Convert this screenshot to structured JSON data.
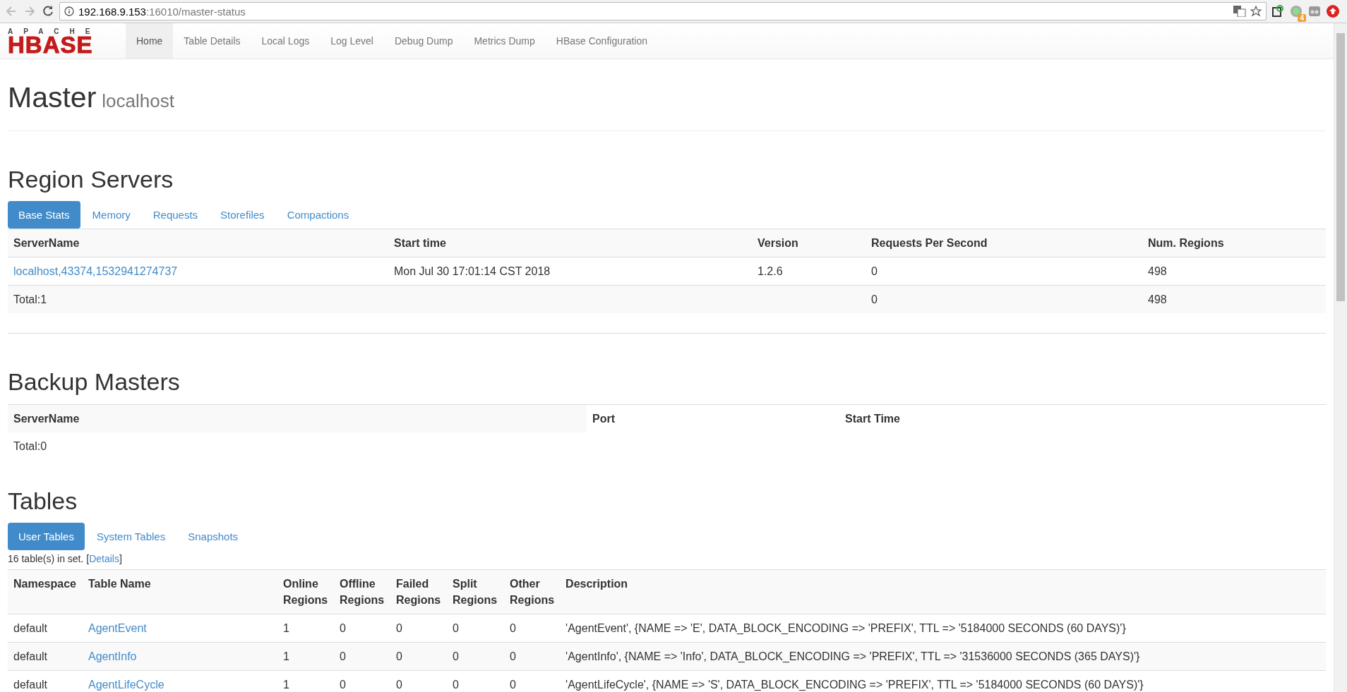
{
  "browser": {
    "url_host": "192.168.9.153",
    "url_path": ":16010/master-status",
    "extension_badge": "4"
  },
  "navbar": {
    "logo_top": "APACHE",
    "logo_main": "HBASE",
    "items": [
      {
        "label": "Home",
        "selected": true
      },
      {
        "label": "Table Details",
        "selected": false
      },
      {
        "label": "Local Logs",
        "selected": false
      },
      {
        "label": "Log Level",
        "selected": false
      },
      {
        "label": "Debug Dump",
        "selected": false
      },
      {
        "label": "Metrics Dump",
        "selected": false
      },
      {
        "label": "HBase Configuration",
        "selected": false
      }
    ]
  },
  "header": {
    "title": "Master",
    "subtitle": "localhost"
  },
  "region_servers": {
    "title": "Region Servers",
    "tabs": [
      {
        "label": "Base Stats",
        "selected": true
      },
      {
        "label": "Memory",
        "selected": false
      },
      {
        "label": "Requests",
        "selected": false
      },
      {
        "label": "Storefiles",
        "selected": false
      },
      {
        "label": "Compactions",
        "selected": false
      }
    ],
    "columns": [
      "ServerName",
      "Start time",
      "Version",
      "Requests Per Second",
      "Num. Regions"
    ],
    "rows": [
      {
        "server_name": "localhost,43374,1532941274737",
        "start_time": "Mon Jul 30 17:01:14 CST 2018",
        "version": "1.2.6",
        "requests_per_second": "0",
        "num_regions": "498"
      }
    ],
    "total": {
      "label": "Total:1",
      "requests_per_second": "0",
      "num_regions": "498"
    }
  },
  "backup_masters": {
    "title": "Backup Masters",
    "columns": [
      "ServerName",
      "Port",
      "Start Time"
    ],
    "total": "Total:0"
  },
  "tables": {
    "title": "Tables",
    "tabs": [
      {
        "label": "User Tables",
        "selected": true
      },
      {
        "label": "System Tables",
        "selected": false
      },
      {
        "label": "Snapshots",
        "selected": false
      }
    ],
    "summary_prefix": "16 table(s) in set. [",
    "summary_link": "Details",
    "summary_suffix": "]",
    "columns": [
      "Namespace",
      "Table Name",
      "Online Regions",
      "Offline Regions",
      "Failed Regions",
      "Split Regions",
      "Other Regions",
      "Description"
    ],
    "rows": [
      {
        "namespace": "default",
        "name": "AgentEvent",
        "online": "1",
        "offline": "0",
        "failed": "0",
        "split": "0",
        "other": "0",
        "description": "'AgentEvent', {NAME => 'E', DATA_BLOCK_ENCODING => 'PREFIX', TTL => '5184000 SECONDS (60 DAYS)'}"
      },
      {
        "namespace": "default",
        "name": "AgentInfo",
        "online": "1",
        "offline": "0",
        "failed": "0",
        "split": "0",
        "other": "0",
        "description": "'AgentInfo', {NAME => 'Info', DATA_BLOCK_ENCODING => 'PREFIX', TTL => '31536000 SECONDS (365 DAYS)'}"
      },
      {
        "namespace": "default",
        "name": "AgentLifeCycle",
        "online": "1",
        "offline": "0",
        "failed": "0",
        "split": "0",
        "other": "0",
        "description": "'AgentLifeCycle', {NAME => 'S', DATA_BLOCK_ENCODING => 'PREFIX', TTL => '5184000 SECONDS (60 DAYS)'}"
      }
    ]
  }
}
